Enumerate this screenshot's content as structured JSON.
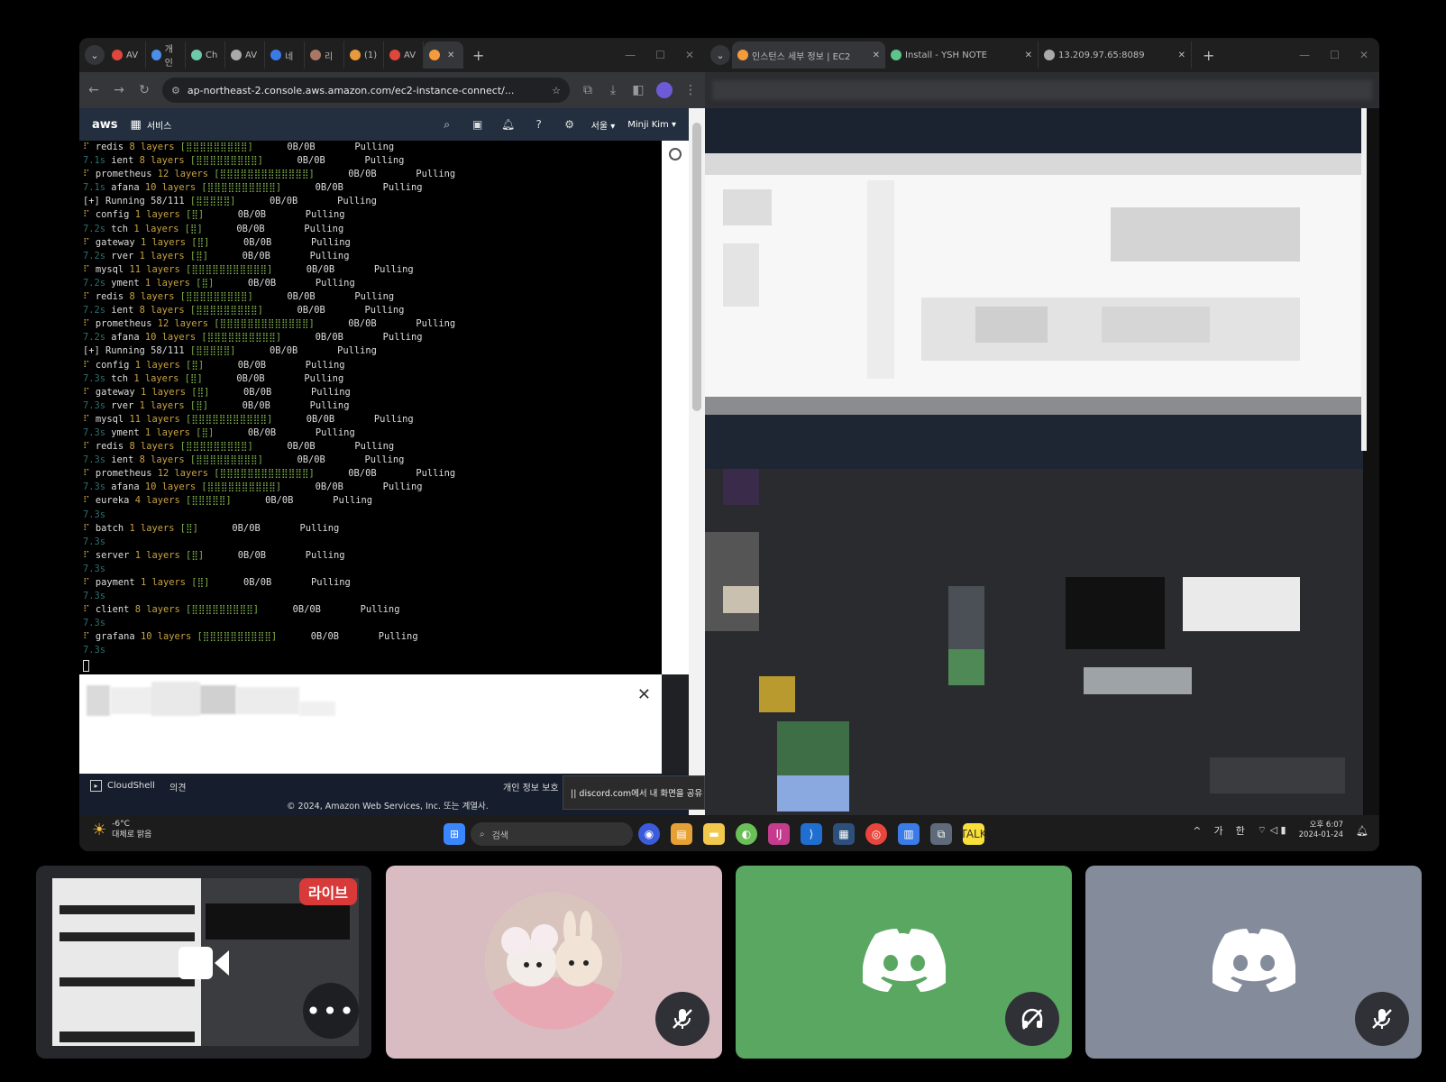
{
  "left_browser": {
    "tabs": [
      {
        "label": "AV",
        "color": "#e0473c"
      },
      {
        "label": "개인",
        "color": "#4a8fe8"
      },
      {
        "label": "Ch",
        "color": "#6ec9a8"
      },
      {
        "label": "AV",
        "color": "#aaaaaa"
      },
      {
        "label": "네",
        "color": "#3b7be8"
      },
      {
        "label": "리",
        "color": "#aa7766"
      },
      {
        "label": "(1)",
        "color": "#e89a3c"
      },
      {
        "label": "AV",
        "color": "#e0473c"
      },
      {
        "label": "",
        "color": "#f59b3c"
      }
    ],
    "new_tab": "+",
    "address": "ap-northeast-2.console.aws.amazon.com/ec2-instance-connect/...",
    "aws": {
      "logo": "aws",
      "services": "서비스",
      "region": "서울 ▾",
      "user": "Minji Kim ▾"
    },
    "terminal_lines": [
      {
        "prefix": "⠏",
        "pre_style": "t",
        "name": "redis",
        "layers": "8 layers",
        "bar": "[⣿⣿⣿⣿⣿⣿⣿⣿⣿]",
        "size": "0B/0B",
        "status": "Pulling"
      },
      {
        "prefix": "7.1s",
        "pre_style": "dim",
        "name": "ient",
        "layers": "8 layers",
        "bar": "[⣿⣿⣿⣿⣿⣿⣿⣿⣿]",
        "size": "0B/0B",
        "status": "Pulling"
      },
      {
        "prefix": "⠏",
        "pre_style": "t",
        "name": "prometheus",
        "layers": "12 layers",
        "bar": "[⣿⣿⣿⣿⣿⣿⣿⣿⣿⣿⣿⣿⣿]",
        "size": "0B/0B",
        "status": "Pulling"
      },
      {
        "prefix": "7.1s",
        "pre_style": "dim",
        "name": "afana",
        "layers": "10 layers",
        "bar": "[⣿⣿⣿⣿⣿⣿⣿⣿⣿⣿]",
        "size": "0B/0B",
        "status": "Pulling"
      },
      {
        "prefix": "[+] Running 58/111",
        "pre_style": "",
        "name": "",
        "layers": "",
        "bar": "[⣿⣿⣿⣿⣿]",
        "size": "0B/0B",
        "status": "Pulling"
      },
      {
        "prefix": "⠏",
        "pre_style": "t",
        "name": "config",
        "layers": "1 layers",
        "bar": "[⣿]",
        "size": "0B/0B",
        "status": "Pulling"
      },
      {
        "prefix": "7.2s",
        "pre_style": "dim",
        "name": "tch",
        "layers": "1 layers",
        "bar": "[⣿]",
        "size": "0B/0B",
        "status": "Pulling"
      },
      {
        "prefix": "⠏",
        "pre_style": "t",
        "name": "gateway",
        "layers": "1 layers",
        "bar": "[⣿]",
        "size": "0B/0B",
        "status": "Pulling"
      },
      {
        "prefix": "7.2s",
        "pre_style": "dim",
        "name": "rver",
        "layers": "1 layers",
        "bar": "[⣿]",
        "size": "0B/0B",
        "status": "Pulling"
      },
      {
        "prefix": "⠏",
        "pre_style": "t",
        "name": "mysql",
        "layers": "11 layers",
        "bar": "[⣿⣿⣿⣿⣿⣿⣿⣿⣿⣿⣿]",
        "size": "0B/0B",
        "status": "Pulling"
      },
      {
        "prefix": "7.2s",
        "pre_style": "dim",
        "name": "yment",
        "layers": "1 layers",
        "bar": "[⣿]",
        "size": "0B/0B",
        "status": "Pulling"
      },
      {
        "prefix": "⠏",
        "pre_style": "t",
        "name": "redis",
        "layers": "8 layers",
        "bar": "[⣿⣿⣿⣿⣿⣿⣿⣿⣿]",
        "size": "0B/0B",
        "status": "Pulling"
      },
      {
        "prefix": "7.2s",
        "pre_style": "dim",
        "name": "ient",
        "layers": "8 layers",
        "bar": "[⣿⣿⣿⣿⣿⣿⣿⣿⣿]",
        "size": "0B/0B",
        "status": "Pulling"
      },
      {
        "prefix": "⠏",
        "pre_style": "t",
        "name": "prometheus",
        "layers": "12 layers",
        "bar": "[⣿⣿⣿⣿⣿⣿⣿⣿⣿⣿⣿⣿⣿]",
        "size": "0B/0B",
        "status": "Pulling"
      },
      {
        "prefix": "7.2s",
        "pre_style": "dim",
        "name": "afana",
        "layers": "10 layers",
        "bar": "[⣿⣿⣿⣿⣿⣿⣿⣿⣿⣿]",
        "size": "0B/0B",
        "status": "Pulling"
      },
      {
        "prefix": "[+] Running 58/111",
        "pre_style": "",
        "name": "",
        "layers": "",
        "bar": "[⣿⣿⣿⣿⣿]",
        "size": "0B/0B",
        "status": "Pulling"
      },
      {
        "prefix": "⠏",
        "pre_style": "t",
        "name": "config",
        "layers": "1 layers",
        "bar": "[⣿]",
        "size": "0B/0B",
        "status": "Pulling"
      },
      {
        "prefix": "7.3s",
        "pre_style": "dim",
        "name": "tch",
        "layers": "1 layers",
        "bar": "[⣿]",
        "size": "0B/0B",
        "status": "Pulling"
      },
      {
        "prefix": "⠏",
        "pre_style": "t",
        "name": "gateway",
        "layers": "1 layers",
        "bar": "[⣿]",
        "size": "0B/0B",
        "status": "Pulling"
      },
      {
        "prefix": "7.3s",
        "pre_style": "dim",
        "name": "rver",
        "layers": "1 layers",
        "bar": "[⣿]",
        "size": "0B/0B",
        "status": "Pulling"
      },
      {
        "prefix": "⠏",
        "pre_style": "t",
        "name": "mysql",
        "layers": "11 layers",
        "bar": "[⣿⣿⣿⣿⣿⣿⣿⣿⣿⣿⣿]",
        "size": "0B/0B",
        "status": "Pulling"
      },
      {
        "prefix": "7.3s",
        "pre_style": "dim",
        "name": "yment",
        "layers": "1 layers",
        "bar": "[⣿]",
        "size": "0B/0B",
        "status": "Pulling"
      },
      {
        "prefix": "⠏",
        "pre_style": "t",
        "name": "redis",
        "layers": "8 layers",
        "bar": "[⣿⣿⣿⣿⣿⣿⣿⣿⣿]",
        "size": "0B/0B",
        "status": "Pulling"
      },
      {
        "prefix": "7.3s",
        "pre_style": "dim",
        "name": "ient",
        "layers": "8 layers",
        "bar": "[⣿⣿⣿⣿⣿⣿⣿⣿⣿]",
        "size": "0B/0B",
        "status": "Pulling"
      },
      {
        "prefix": "⠏",
        "pre_style": "t",
        "name": "prometheus",
        "layers": "12 layers",
        "bar": "[⣿⣿⣿⣿⣿⣿⣿⣿⣿⣿⣿⣿⣿]",
        "size": "0B/0B",
        "status": "Pulling"
      },
      {
        "prefix": "7.3s",
        "pre_style": "dim",
        "name": "afana",
        "layers": "10 layers",
        "bar": "[⣿⣿⣿⣿⣿⣿⣿⣿⣿⣿]",
        "size": "0B/0B",
        "status": "Pulling"
      },
      {
        "prefix": "⠏",
        "pre_style": "t",
        "name": "eureka",
        "layers": "4 layers",
        "bar": "[⣿⣿⣿⣿⣿]",
        "size": "0B/0B",
        "status": "Pulling"
      },
      {
        "prefix": "7.3s",
        "pre_style": "dim",
        "name": "",
        "layers": "",
        "bar": "",
        "size": "",
        "status": ""
      },
      {
        "prefix": "⠏",
        "pre_style": "t",
        "name": "batch",
        "layers": "1 layers",
        "bar": "[⣿]",
        "size": "0B/0B",
        "status": "Pulling"
      },
      {
        "prefix": "7.3s",
        "pre_style": "dim",
        "name": "",
        "layers": "",
        "bar": "",
        "size": "",
        "status": ""
      },
      {
        "prefix": "⠏",
        "pre_style": "t",
        "name": "server",
        "layers": "1 layers",
        "bar": "[⣿]",
        "size": "0B/0B",
        "status": "Pulling"
      },
      {
        "prefix": "7.3s",
        "pre_style": "dim",
        "name": "",
        "layers": "",
        "bar": "",
        "size": "",
        "status": ""
      },
      {
        "prefix": "⠏",
        "pre_style": "t",
        "name": "payment",
        "layers": "1 layers",
        "bar": "[⣿]",
        "size": "0B/0B",
        "status": "Pulling"
      },
      {
        "prefix": "7.3s",
        "pre_style": "dim",
        "name": "",
        "layers": "",
        "bar": "",
        "size": "",
        "status": ""
      },
      {
        "prefix": "⠏",
        "pre_style": "t",
        "name": "client",
        "layers": "8 layers",
        "bar": "[⣿⣿⣿⣿⣿⣿⣿⣿⣿]",
        "size": "0B/0B",
        "status": "Pulling"
      },
      {
        "prefix": "7.3s",
        "pre_style": "dim",
        "name": "",
        "layers": "",
        "bar": "",
        "size": "",
        "status": ""
      },
      {
        "prefix": "⠏",
        "pre_style": "t",
        "name": "grafana",
        "layers": "10 layers",
        "bar": "[⣿⣿⣿⣿⣿⣿⣿⣿⣿⣿]",
        "size": "0B/0B",
        "status": "Pulling"
      },
      {
        "prefix": "7.3s",
        "pre_style": "dim",
        "name": "",
        "layers": "",
        "bar": "",
        "size": "",
        "status": ""
      }
    ],
    "cloudshell": "CloudShell",
    "feedback": "의견",
    "privacy": "개인 정보 보호",
    "copyright": "© 2024, Amazon Web Services, Inc. 또는 계열사.",
    "share_popup": "|| discord.com에서 내 화면을 공유"
  },
  "right_browser": {
    "tabs": [
      {
        "label": "인스턴스 세부 정보 | EC2",
        "color": "#f59b3c",
        "active": true
      },
      {
        "label": "Install - YSH NOTE",
        "color": "#5cc58a",
        "active": false
      },
      {
        "label": "13.209.97.65:8089",
        "color": "#aaaaaa",
        "active": false
      }
    ],
    "new_tab": "+"
  },
  "taskbar": {
    "weather_temp": "-6°C",
    "weather_desc": "대체로 맑음",
    "search": "검색",
    "tray_caret": "^",
    "ime1": "가",
    "ime2": "한",
    "time": "오후 6:07",
    "date": "2024-01-24"
  },
  "call": {
    "live_badge": "라이브",
    "tile_colors": [
      "#d9bcc1",
      "#5aa762",
      "#848b9a"
    ]
  }
}
